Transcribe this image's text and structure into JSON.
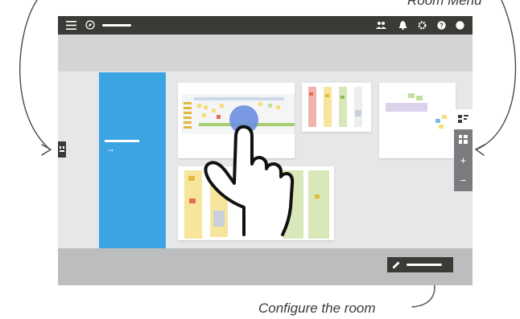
{
  "annotations": {
    "room_menu": "Room Menu",
    "configure": "Configure the room"
  },
  "topbar": {
    "menu_icon": "hamburger-icon",
    "compass_icon": "compass-icon",
    "icons": [
      "people-icon",
      "bell-icon",
      "gear-icon",
      "help-icon",
      "avatar-icon"
    ]
  },
  "zoom_panel": {
    "buttons": [
      "board-view-icon",
      "grid-view-icon",
      "+",
      "−"
    ]
  },
  "blue_card": {
    "arrow": "→"
  },
  "colors": {
    "topbar": "#3b3a37",
    "blue_card": "#3da4e4",
    "highlight": "#6b8ee0"
  }
}
